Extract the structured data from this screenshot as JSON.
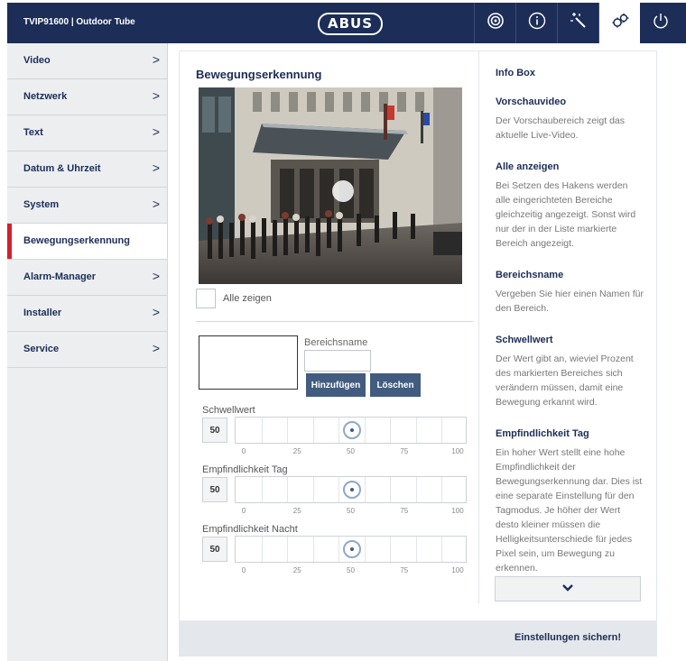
{
  "header": {
    "title": "TVIP91600 | Outdoor Tube",
    "logo": "ABUS",
    "buttons": [
      {
        "name": "live-view-icon"
      },
      {
        "name": "info-icon"
      },
      {
        "name": "magic-wand-icon"
      },
      {
        "name": "settings-icon",
        "active": true
      },
      {
        "name": "power-icon"
      }
    ]
  },
  "sidebar": {
    "items": [
      {
        "label": "Video",
        "chevron": ">"
      },
      {
        "label": "Netzwerk",
        "chevron": ">"
      },
      {
        "label": "Text",
        "chevron": ">"
      },
      {
        "label": "Datum & Uhrzeit",
        "chevron": ">"
      },
      {
        "label": "System",
        "chevron": ">"
      },
      {
        "label": "Bewegungserkennung",
        "chevron": "",
        "active": true
      },
      {
        "label": "Alarm-Manager",
        "chevron": ">"
      },
      {
        "label": "Installer",
        "chevron": ">"
      },
      {
        "label": "Service",
        "chevron": ">"
      }
    ]
  },
  "main": {
    "title": "Bewegungserkennung",
    "show_all_label": "Alle zeigen",
    "area_name_label": "Bereichsname",
    "area_name_value": "",
    "add_button": "Hinzufügen",
    "delete_button": "Löschen",
    "sliders": [
      {
        "label": "Schwellwert",
        "value": "50",
        "level": 50
      },
      {
        "label": "Empfindlichkeit Tag",
        "value": "50",
        "level": 50
      },
      {
        "label": "Empfindlichkeit Nacht",
        "value": "50",
        "level": 50
      }
    ],
    "scale": [
      "0",
      "25",
      "50",
      "75",
      "100"
    ]
  },
  "info_box": {
    "title": "Info Box",
    "sections": [
      {
        "heading": "Vorschauvideo",
        "text": "Der Vorschaubereich zeigt das aktuelle Live-Video."
      },
      {
        "heading": "Alle anzeigen",
        "text": "Bei Setzen des Hakens werden alle eingerichteten Bereiche gleichzeitig angezeigt. Sonst wird nur der in der Liste markierte Bereich angezeigt."
      },
      {
        "heading": "Bereichsname",
        "text": "Vergeben Sie hier einen Namen für den Bereich."
      },
      {
        "heading": "Schwellwert",
        "text": "Der Wert gibt an, wieviel Prozent des markierten Bereiches sich verändern müssen, damit eine Bewegung erkannt wird."
      },
      {
        "heading": "Empfindlichkeit Tag",
        "text": "Ein hoher Wert stellt eine hohe Empfindlichkeit der Bewegungserkennung dar. Dies ist eine separate Einstellung für den Tagmodus. Je höher der Wert desto kleiner müssen die Helligkeitsunterschiede für jedes Pixel sein, um Bewegung zu erkennen."
      }
    ]
  },
  "footer": {
    "save_label": "Einstellungen sichern!"
  },
  "colors": {
    "header": "#1c2d57",
    "active_marker": "#d3202e",
    "button": "#425c7f"
  }
}
